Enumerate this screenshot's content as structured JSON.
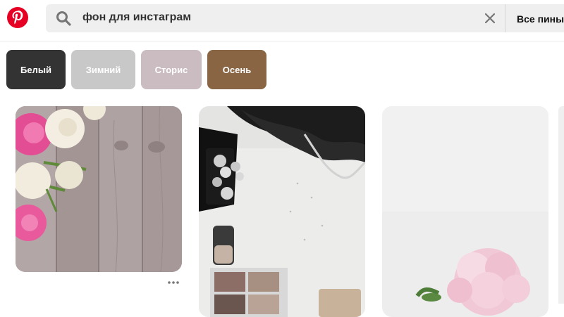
{
  "search": {
    "query": "фон для инстаграм",
    "scope_label": "Все пины"
  },
  "filters": [
    {
      "label": "Белый",
      "color": "#333333"
    },
    {
      "label": "Зимний",
      "color": "#c8c8c8"
    },
    {
      "label": "Сторис",
      "color": "#cbbcc2"
    },
    {
      "label": "Осень",
      "color": "#8a6543"
    }
  ],
  "brand_color": "#e60023",
  "pins": [
    {
      "icon": "pink-roses-on-wood-image"
    },
    {
      "icon": "black-feathers-jewelry-makeup-image"
    },
    {
      "icon": "pink-peony-on-white-image"
    }
  ]
}
